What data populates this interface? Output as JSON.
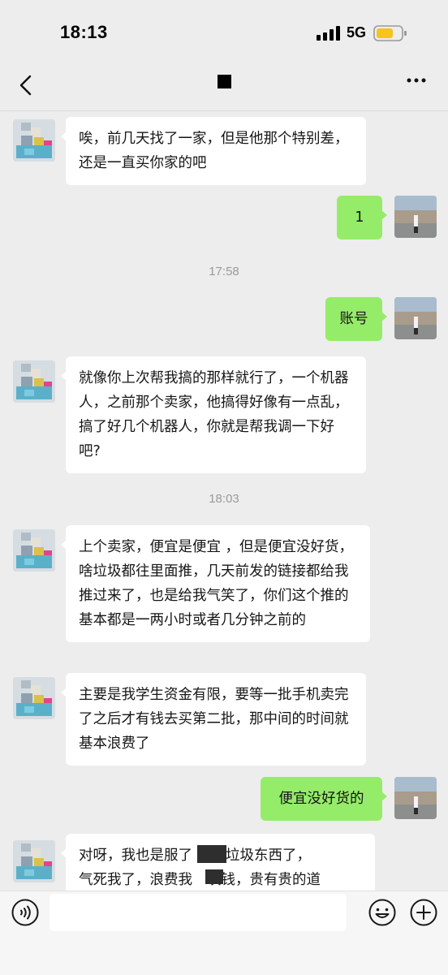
{
  "status_bar": {
    "time": "18:13",
    "network": "5G",
    "signal_icon": "signal-bars-icon",
    "battery_icon": "battery-icon"
  },
  "nav": {
    "back_icon": "chevron-left-icon",
    "more_icon": "more-dots-icon"
  },
  "messages": [
    {
      "side": "left",
      "text": "唉，前几天找了一家，但是他那个特别差，还是一直买你家的吧"
    },
    {
      "side": "right",
      "text": "1"
    },
    {
      "type": "time",
      "text": "17:58"
    },
    {
      "side": "right",
      "text": "账号"
    },
    {
      "side": "left",
      "text": "就像你上次帮我搞的那样就行了，一个机器人，之前那个卖家，他搞得好像有一点乱，搞了好几个机器人，你就是帮我调一下好吧?"
    },
    {
      "type": "time",
      "text": "18:03"
    },
    {
      "side": "left",
      "text": "上个卖家，便宜是便宜 ，但是便宜没好货，啥垃圾都往里面推，几天前发的链接都给我推过来了，也是给我气笑了，你们这个推的基本都是一两小时或者几分钟之前的"
    },
    {
      "side": "left",
      "text": "主要是我学生资金有限，要等一批手机卖完了之后才有钱去买第二批，那中间的时间就基本浪费了"
    },
    {
      "side": "right",
      "text": "便宜没好货的"
    },
    {
      "side": "left",
      "text_part1": "对呀，我也是服了",
      "text_part2": "那个垃圾东西了，",
      "text_part3": "气死我了，浪费我",
      "text_part4": "块钱，贵有贵的道"
    }
  ],
  "input_bar": {
    "voice_icon": "voice-icon",
    "emoji_icon": "emoji-icon",
    "plus_icon": "plus-icon",
    "input_value": ""
  },
  "colors": {
    "background": "#ededed",
    "incoming_bubble": "#ffffff",
    "outgoing_bubble": "#95ec69",
    "timestamp": "#9a9a9a"
  }
}
